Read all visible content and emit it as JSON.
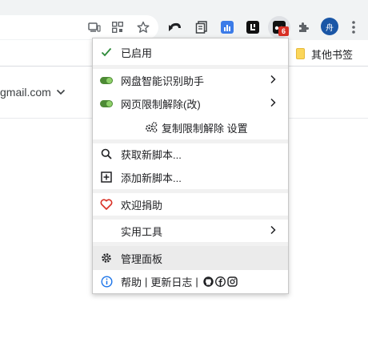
{
  "bookmarks_bar": {
    "other_bookmarks": "其他书签"
  },
  "account": {
    "email": "gmail.com"
  },
  "avatar": {
    "initial": "舟"
  },
  "extension_badge": "6",
  "menu": {
    "enabled": "已启用",
    "scripts": [
      {
        "label": "网盘智能识别助手",
        "enabled": true
      },
      {
        "label": "网页限制解除(改)",
        "enabled": true
      }
    ],
    "script_command": "复制限制解除 设置",
    "get_new_script": "获取新脚本...",
    "add_new_script": "添加新脚本...",
    "donate": "欢迎捐助",
    "utilities": "实用工具",
    "dashboard": "管理面板",
    "help": "帮助",
    "changelog": "更新日志"
  },
  "colors": {
    "check": "#2e8b3a",
    "toggle_on": "#4d8a35",
    "heart": "#d93025",
    "info": "#1a73e8",
    "avatar_bg": "#1a56a6"
  }
}
